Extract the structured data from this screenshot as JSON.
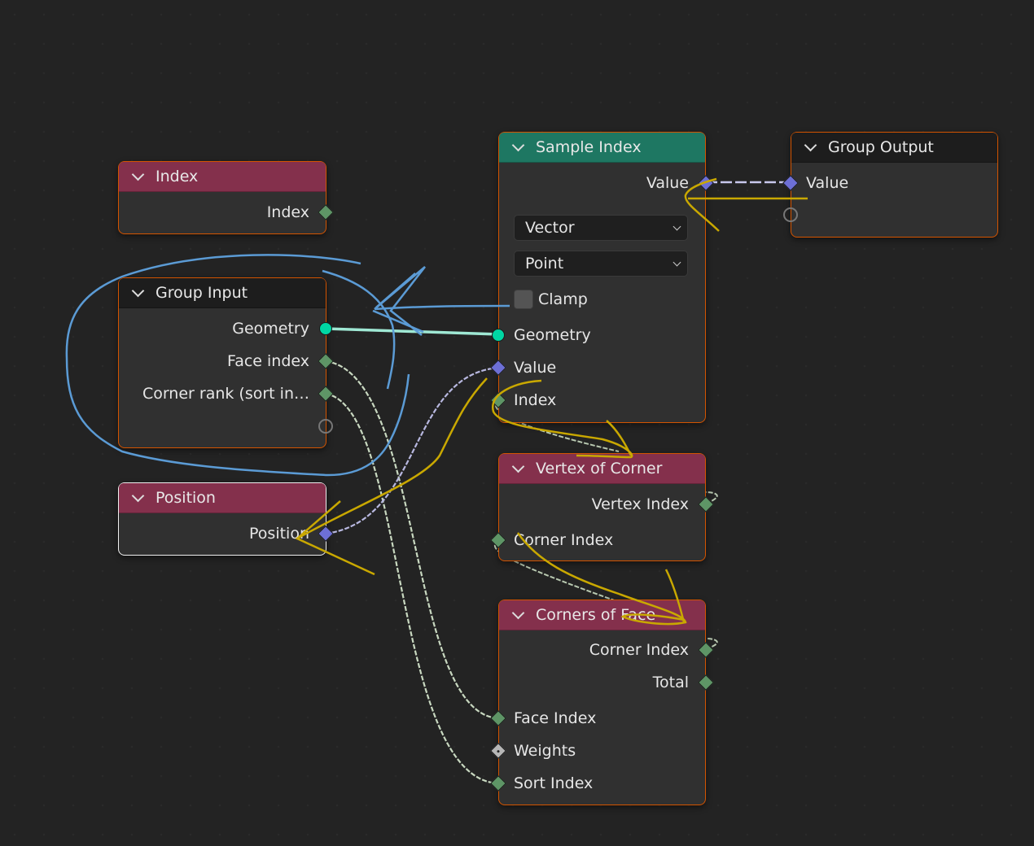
{
  "nodes": {
    "index": {
      "title": "Index",
      "outputs": [
        "Index"
      ]
    },
    "group_input": {
      "title": "Group Input",
      "outputs": [
        "Geometry",
        "Face index",
        "Corner rank (sort in…"
      ]
    },
    "position": {
      "title": "Position",
      "outputs": [
        "Position"
      ]
    },
    "sample_index": {
      "title": "Sample Index",
      "outputs": [
        "Value"
      ],
      "data_type": "Vector",
      "domain": "Point",
      "clamp_label": "Clamp",
      "clamp_checked": false,
      "inputs": [
        "Geometry",
        "Value",
        "Index"
      ]
    },
    "group_output": {
      "title": "Group Output",
      "inputs": [
        "Value"
      ]
    },
    "vertex_of_corner": {
      "title": "Vertex of Corner",
      "outputs": [
        "Vertex Index"
      ],
      "inputs": [
        "Corner Index"
      ]
    },
    "corners_of_face": {
      "title": "Corners of Face",
      "outputs": [
        "Corner Index",
        "Total"
      ],
      "inputs": [
        "Face Index",
        "Weights",
        "Sort Index"
      ]
    }
  },
  "colors": {
    "node_border_selected": "#d35400",
    "node_border_active": "#f0f0f0",
    "input_header": "#84304c",
    "geometry_header": "#1e7762",
    "group_header": "#1d1d1d",
    "socket_integer": "#5e9566",
    "socket_vector": "#6d6fd6",
    "socket_geometry": "#00d6a3",
    "socket_float": "#b7b7b7",
    "annotation_blue": "#5b9bd5",
    "annotation_yellow": "#c9a800"
  }
}
